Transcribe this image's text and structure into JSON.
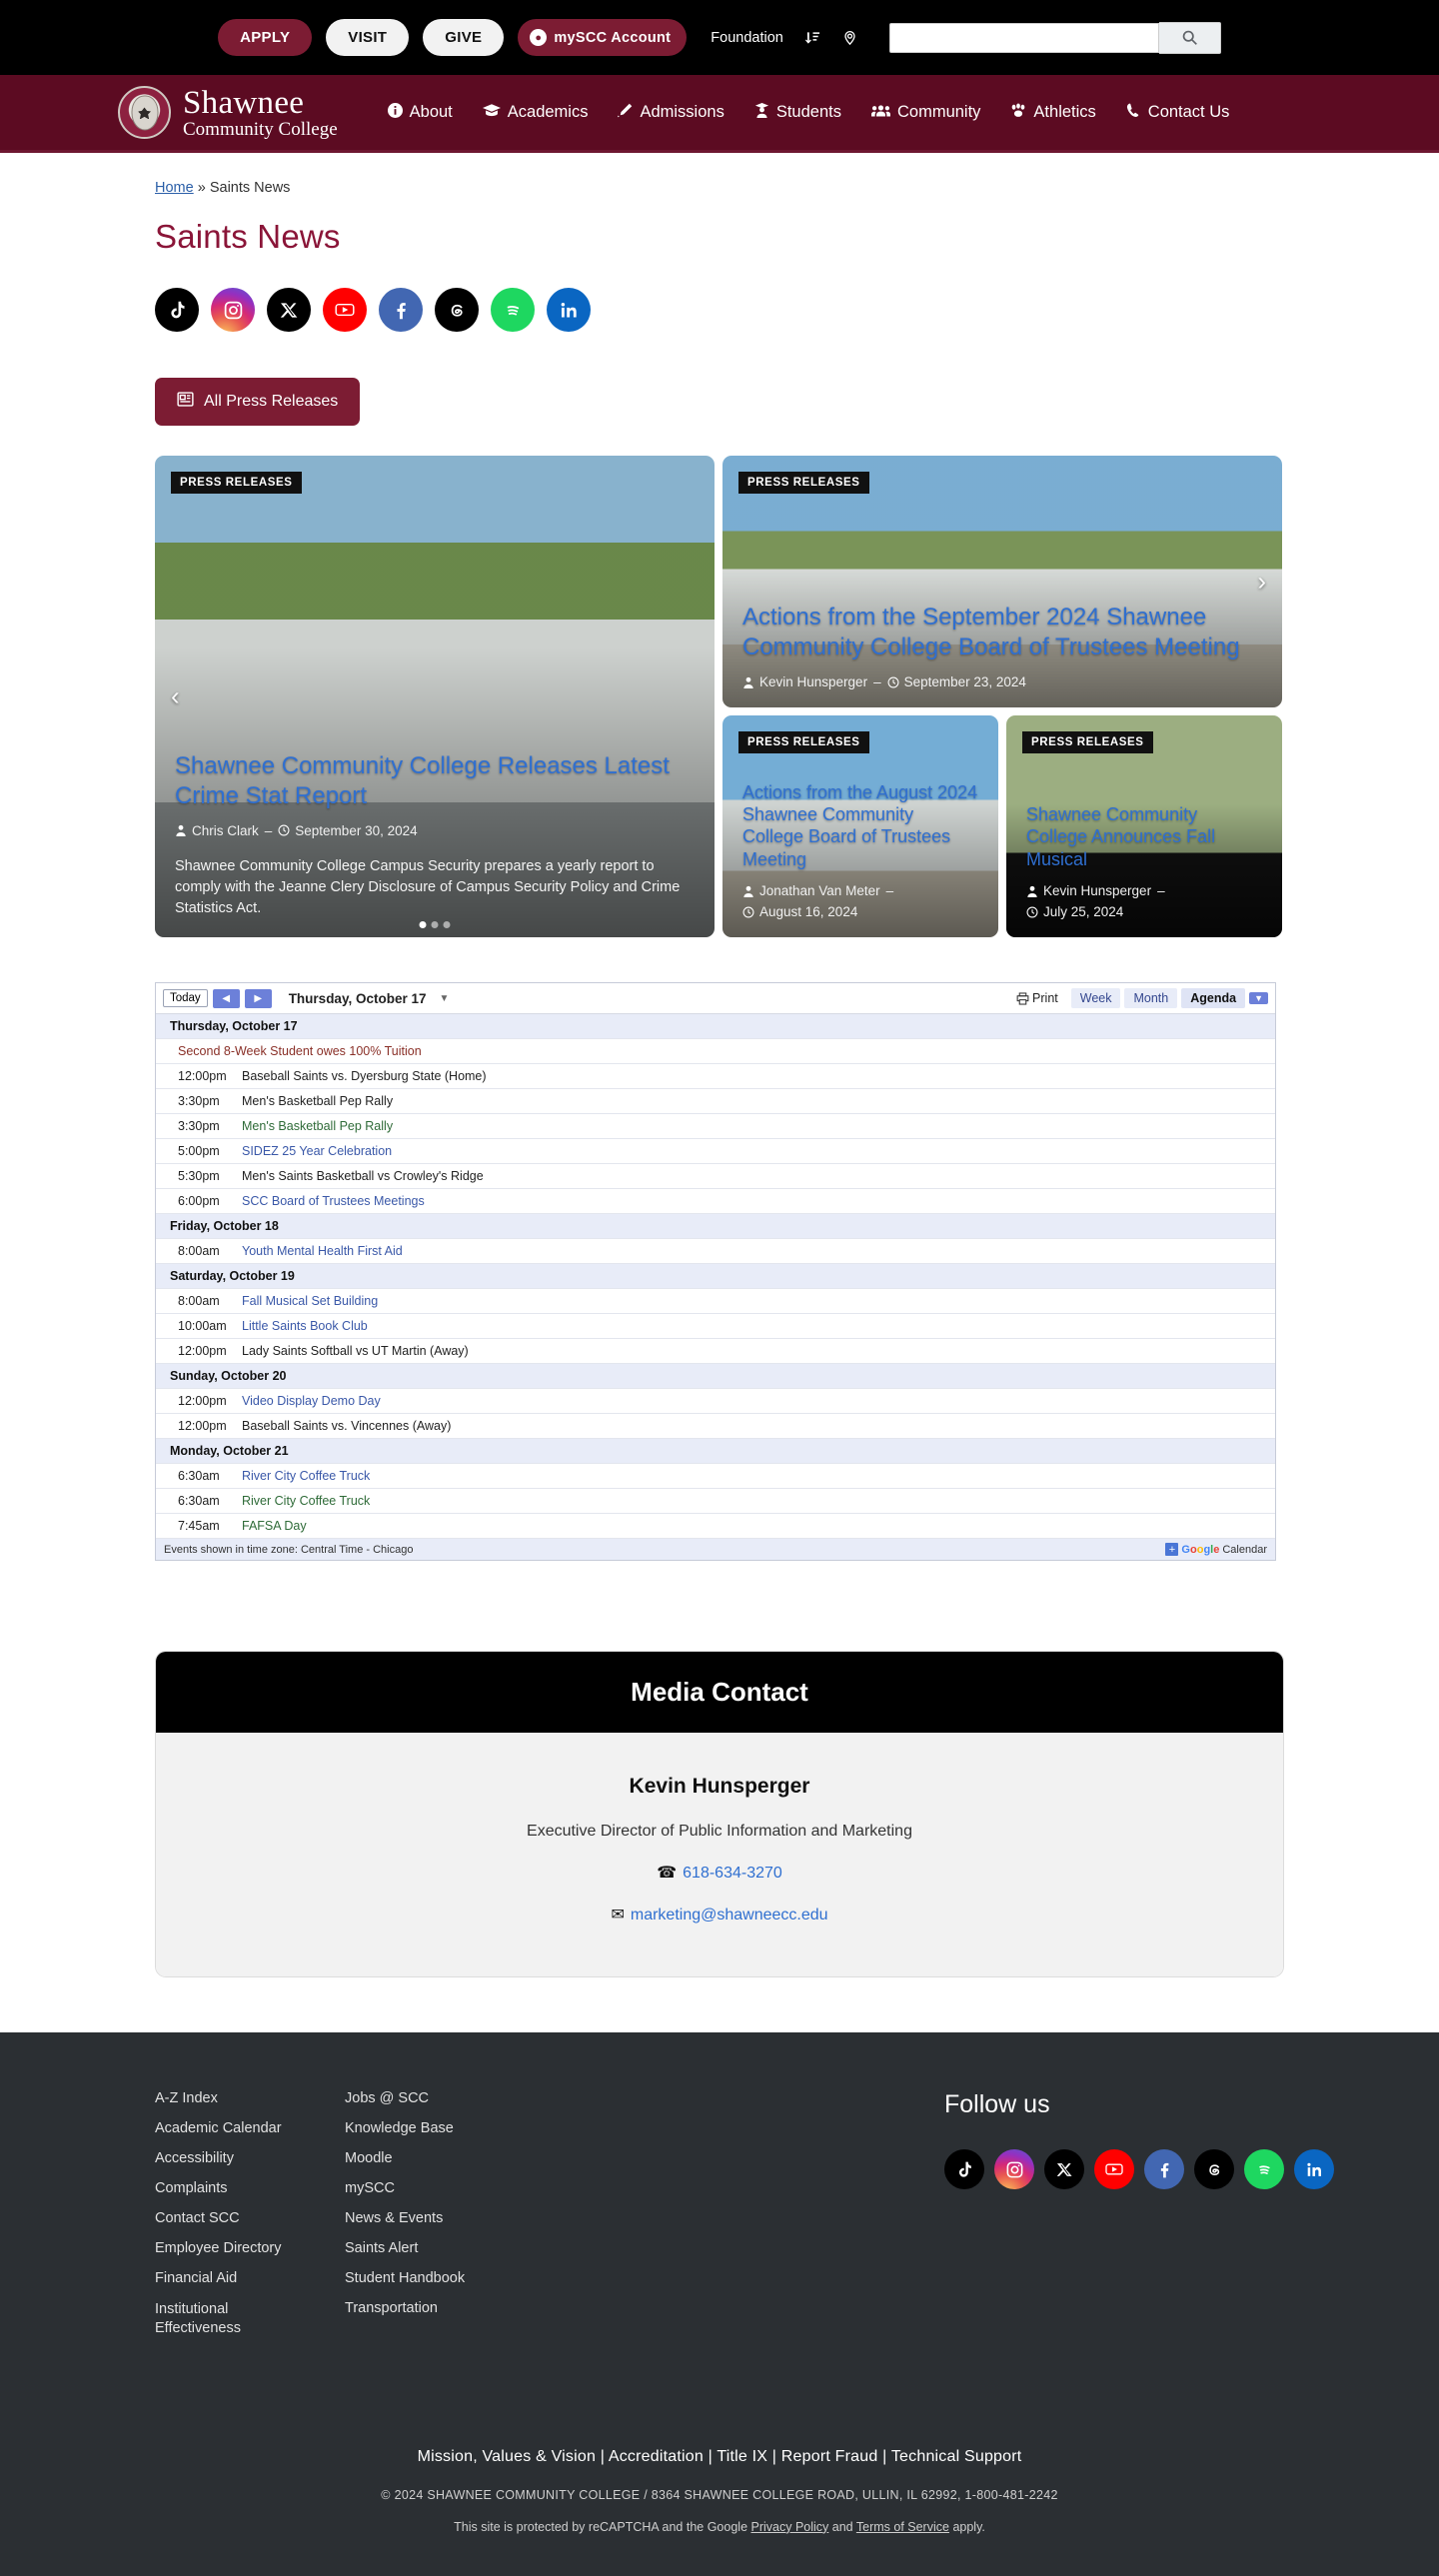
{
  "utility": {
    "apply_label": "APPLY",
    "visit_label": "VISIT",
    "give_label": "GIVE",
    "account_label": "mySCC Account",
    "foundation_label": "Foundation",
    "search_placeholder": ""
  },
  "brand": {
    "line1": "Shawnee",
    "line2": "Community College"
  },
  "nav": {
    "items": [
      {
        "label": "About",
        "icon": "info-icon"
      },
      {
        "label": "Academics",
        "icon": "graduation-cap-icon"
      },
      {
        "label": "Admissions",
        "icon": "pen-icon"
      },
      {
        "label": "Students",
        "icon": "user-graduate-icon"
      },
      {
        "label": "Community",
        "icon": "users-icon"
      },
      {
        "label": "Athletics",
        "icon": "paw-icon"
      },
      {
        "label": "Contact Us",
        "icon": "phone-icon"
      }
    ]
  },
  "breadcrumb": {
    "home": "Home",
    "separator": "»",
    "current": "Saints News"
  },
  "page_title": "Saints News",
  "social": [
    {
      "name": "tiktok",
      "glyph": "♪"
    },
    {
      "name": "instagram",
      "glyph": "◉"
    },
    {
      "name": "x-twitter",
      "glyph": "X"
    },
    {
      "name": "youtube",
      "glyph": "▶"
    },
    {
      "name": "facebook",
      "glyph": "f"
    },
    {
      "name": "threads",
      "glyph": "@"
    },
    {
      "name": "spotify",
      "glyph": "≋"
    },
    {
      "name": "linkedin",
      "glyph": "in"
    }
  ],
  "press_button": {
    "label": "All Press Releases",
    "icon": "newspaper-icon"
  },
  "news": {
    "tag": "PRESS RELEASES",
    "cards": [
      {
        "title": "Shawnee Community College Releases Latest Crime Stat Report",
        "author": "Chris Clark",
        "date": "September 30, 2024",
        "excerpt": "Shawnee Community College Campus Security prepares a yearly report to comply with the Jeanne Clery Disclosure of Campus Security Policy and Crime Statistics Act."
      },
      {
        "title": "Actions from the September 2024 Shawnee Community College Board of Trustees Meeting",
        "author": "Kevin Hunsperger",
        "date": "September 23, 2024"
      },
      {
        "title": "Actions from the August 2024 Shawnee Community College Board of Trustees Meeting",
        "author": "Jonathan Van Meter",
        "date": "August 16, 2024"
      },
      {
        "title": "Shawnee Community College Announces Fall Musical",
        "author": "Kevin Hunsperger",
        "date": "July 25, 2024"
      }
    ],
    "prev_arrow": "‹",
    "next_arrow": "›"
  },
  "calendar": {
    "today_label": "Today",
    "prev_label": "◀",
    "next_label": "▶",
    "current_date": "Thursday, October 17",
    "print_label": "Print",
    "views": [
      "Week",
      "Month",
      "Agenda"
    ],
    "active_view": "Agenda",
    "timezone_note": "Events shown in time zone: Central Time - Chicago",
    "gcal_label": "Calendar",
    "google_letters": [
      "G",
      "o",
      "o",
      "g",
      "l",
      "e"
    ],
    "days": [
      {
        "label": "Thursday, October 17",
        "events": [
          {
            "time": "",
            "name": "Second 8-Week Student owes 100% Tuition",
            "style": "red",
            "allday": true
          },
          {
            "time": "12:00pm",
            "name": "Baseball Saints vs. Dyersburg State (Home)",
            "style": "plain"
          },
          {
            "time": "3:30pm",
            "name": "Men's Basketball Pep Rally",
            "style": "plain"
          },
          {
            "time": "3:30pm",
            "name": "Men's Basketball Pep Rally",
            "style": "green"
          },
          {
            "time": "5:00pm",
            "name": "SIDEZ 25 Year Celebration",
            "style": "link"
          },
          {
            "time": "5:30pm",
            "name": "Men's Saints Basketball vs Crowley's Ridge",
            "style": "plain"
          },
          {
            "time": "6:00pm",
            "name": "SCC Board of Trustees Meetings",
            "style": "link"
          }
        ]
      },
      {
        "label": "Friday, October 18",
        "events": [
          {
            "time": "8:00am",
            "name": "Youth Mental Health First Aid",
            "style": "link"
          }
        ]
      },
      {
        "label": "Saturday, October 19",
        "events": [
          {
            "time": "8:00am",
            "name": "Fall Musical Set Building",
            "style": "link"
          },
          {
            "time": "10:00am",
            "name": "Little Saints Book Club",
            "style": "link"
          },
          {
            "time": "12:00pm",
            "name": "Lady Saints Softball vs UT Martin (Away)",
            "style": "plain"
          }
        ]
      },
      {
        "label": "Sunday, October 20",
        "events": [
          {
            "time": "12:00pm",
            "name": "Video Display Demo Day",
            "style": "link"
          },
          {
            "time": "12:00pm",
            "name": "Baseball Saints vs. Vincennes (Away)",
            "style": "plain"
          }
        ]
      },
      {
        "label": "Monday, October 21",
        "events": [
          {
            "time": "6:30am",
            "name": "River City Coffee Truck",
            "style": "link"
          },
          {
            "time": "6:30am",
            "name": "River City Coffee Truck",
            "style": "green"
          },
          {
            "time": "7:45am",
            "name": "FAFSA Day",
            "style": "green"
          }
        ]
      }
    ]
  },
  "media_contact": {
    "heading": "Media Contact",
    "name": "Kevin Hunsperger",
    "role": "Executive Director of Public Information and Marketing",
    "phone": "618-634-3270",
    "email": "marketing@shawneecc.edu"
  },
  "footer": {
    "col1": [
      "A-Z Index",
      "Academic Calendar",
      "Accessibility",
      "Complaints",
      "Contact SCC",
      "Employee Directory",
      "Financial Aid",
      "Institutional Effectiveness"
    ],
    "col2": [
      "Jobs @ SCC",
      "Knowledge Base",
      "Moodle",
      "mySCC",
      "News & Events",
      "Saints Alert",
      "Student Handbook",
      "Transportation"
    ],
    "follow_heading": "Follow us",
    "bottom_links": [
      "Mission, Values & Vision",
      "Accreditation",
      "Title IX",
      "Report Fraud",
      "Technical Support"
    ],
    "copyright": "© 2024 SHAWNEE COMMUNITY COLLEGE / 8364 SHAWNEE COLLEGE ROAD, ULLIN, IL 62992, 1-800-481-2242",
    "recaptcha_pre": "This site is protected by reCAPTCHA and the Google ",
    "privacy": "Privacy Policy",
    "recaptcha_mid": " and ",
    "terms": "Terms of Service",
    "recaptcha_post": " apply."
  },
  "colors": {
    "maroon": "#5c0b22",
    "brand_red": "#7c1c33",
    "title_red": "#8a1538",
    "link_blue": "#2f6fd0"
  }
}
